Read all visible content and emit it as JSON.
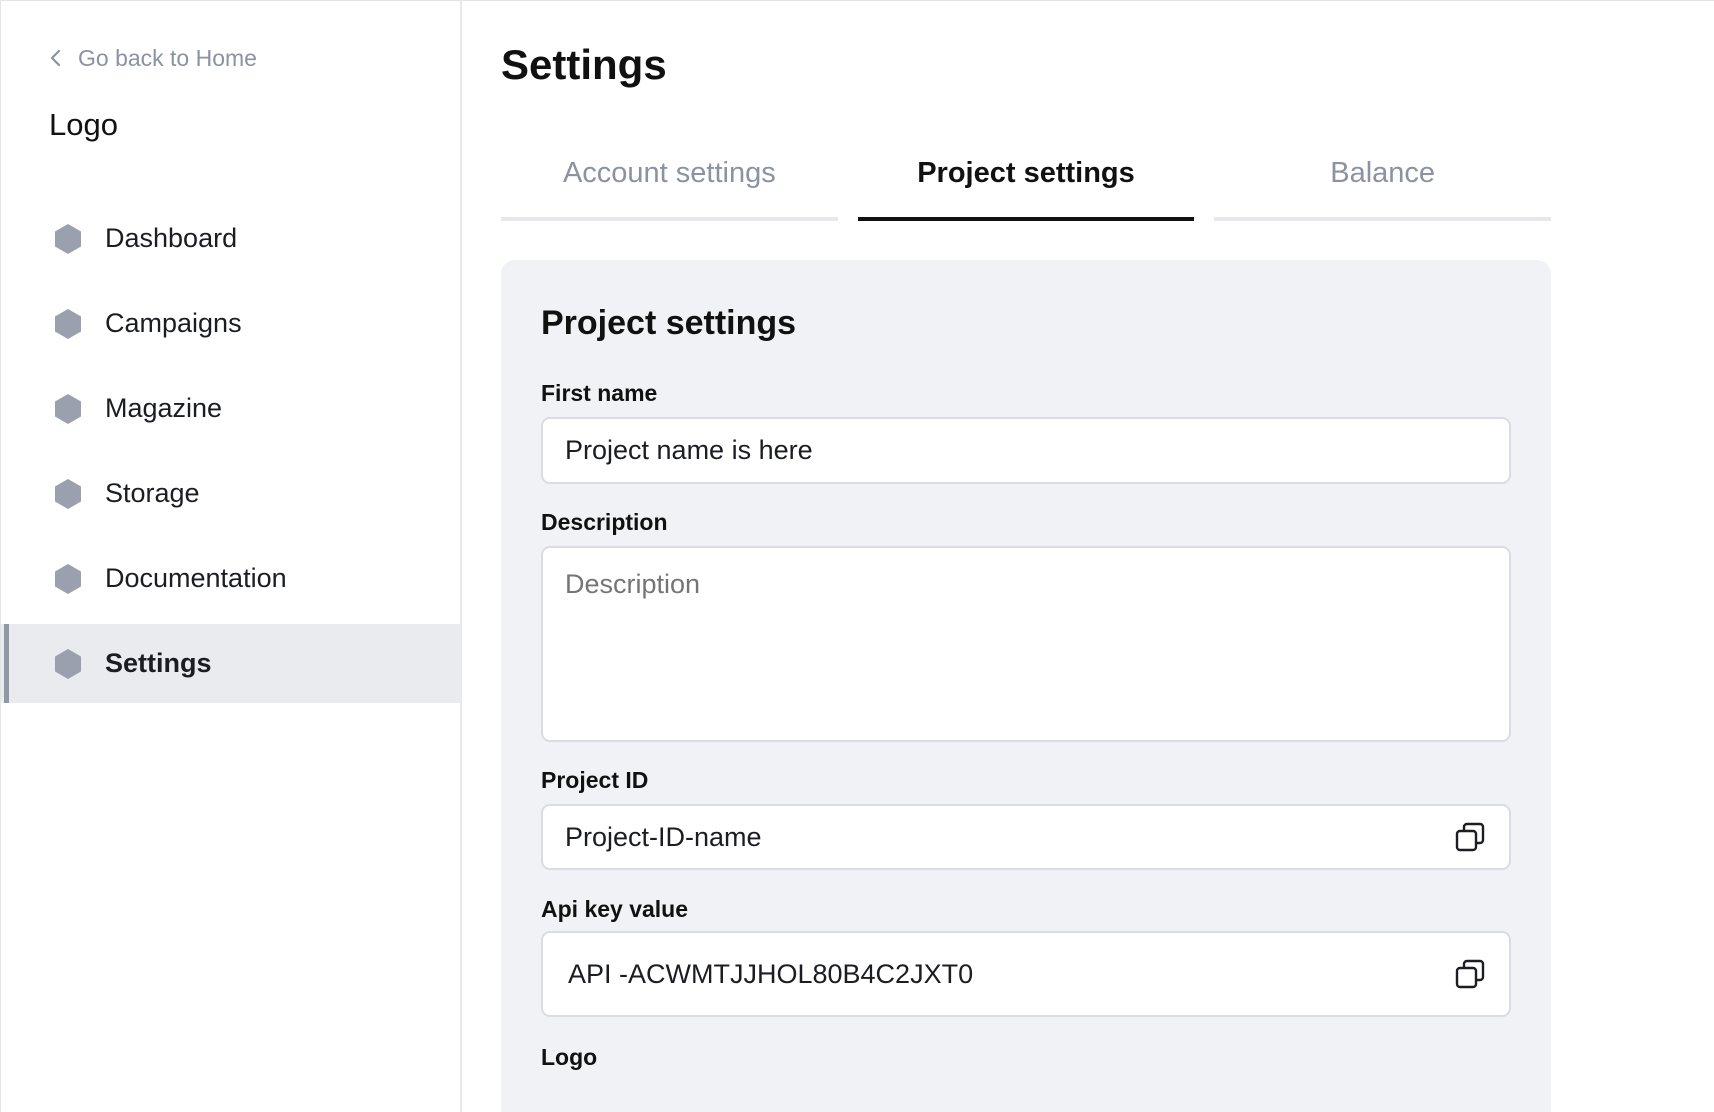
{
  "sidebar": {
    "back_label": "Go back to Home",
    "logo_text": "Logo",
    "items": [
      {
        "label": "Dashboard",
        "icon": "hexagon-icon"
      },
      {
        "label": "Campaigns",
        "icon": "hexagon-icon"
      },
      {
        "label": "Magazine",
        "icon": "hexagon-icon"
      },
      {
        "label": "Storage",
        "icon": "hexagon-icon"
      },
      {
        "label": "Documentation",
        "icon": "hexagon-icon"
      },
      {
        "label": "Settings",
        "icon": "hexagon-icon",
        "active": true
      }
    ]
  },
  "main": {
    "title": "Settings",
    "tabs": [
      {
        "label": "Account settings"
      },
      {
        "label": "Project settings",
        "active": true
      },
      {
        "label": "Balance"
      }
    ],
    "card": {
      "title": "Project settings",
      "first_name": {
        "label": "First name",
        "value": "Project name is here"
      },
      "description": {
        "label": "Description",
        "placeholder": "Description"
      },
      "project_id": {
        "label": "Project ID",
        "value": "Project-ID-name",
        "icon": "copy-icon"
      },
      "api_key": {
        "label": "Api key value",
        "value": "API -ACWMTJJHOL80B4C2JXT0",
        "icon": "copy-icon"
      },
      "logo_label": "Logo"
    }
  },
  "colors": {
    "accent": "#111111",
    "muted_text": "#8b92a3",
    "icon_fill": "#9aa0ae",
    "card_bg": "#f1f2f5",
    "active_nav_bg": "#eaebef"
  }
}
